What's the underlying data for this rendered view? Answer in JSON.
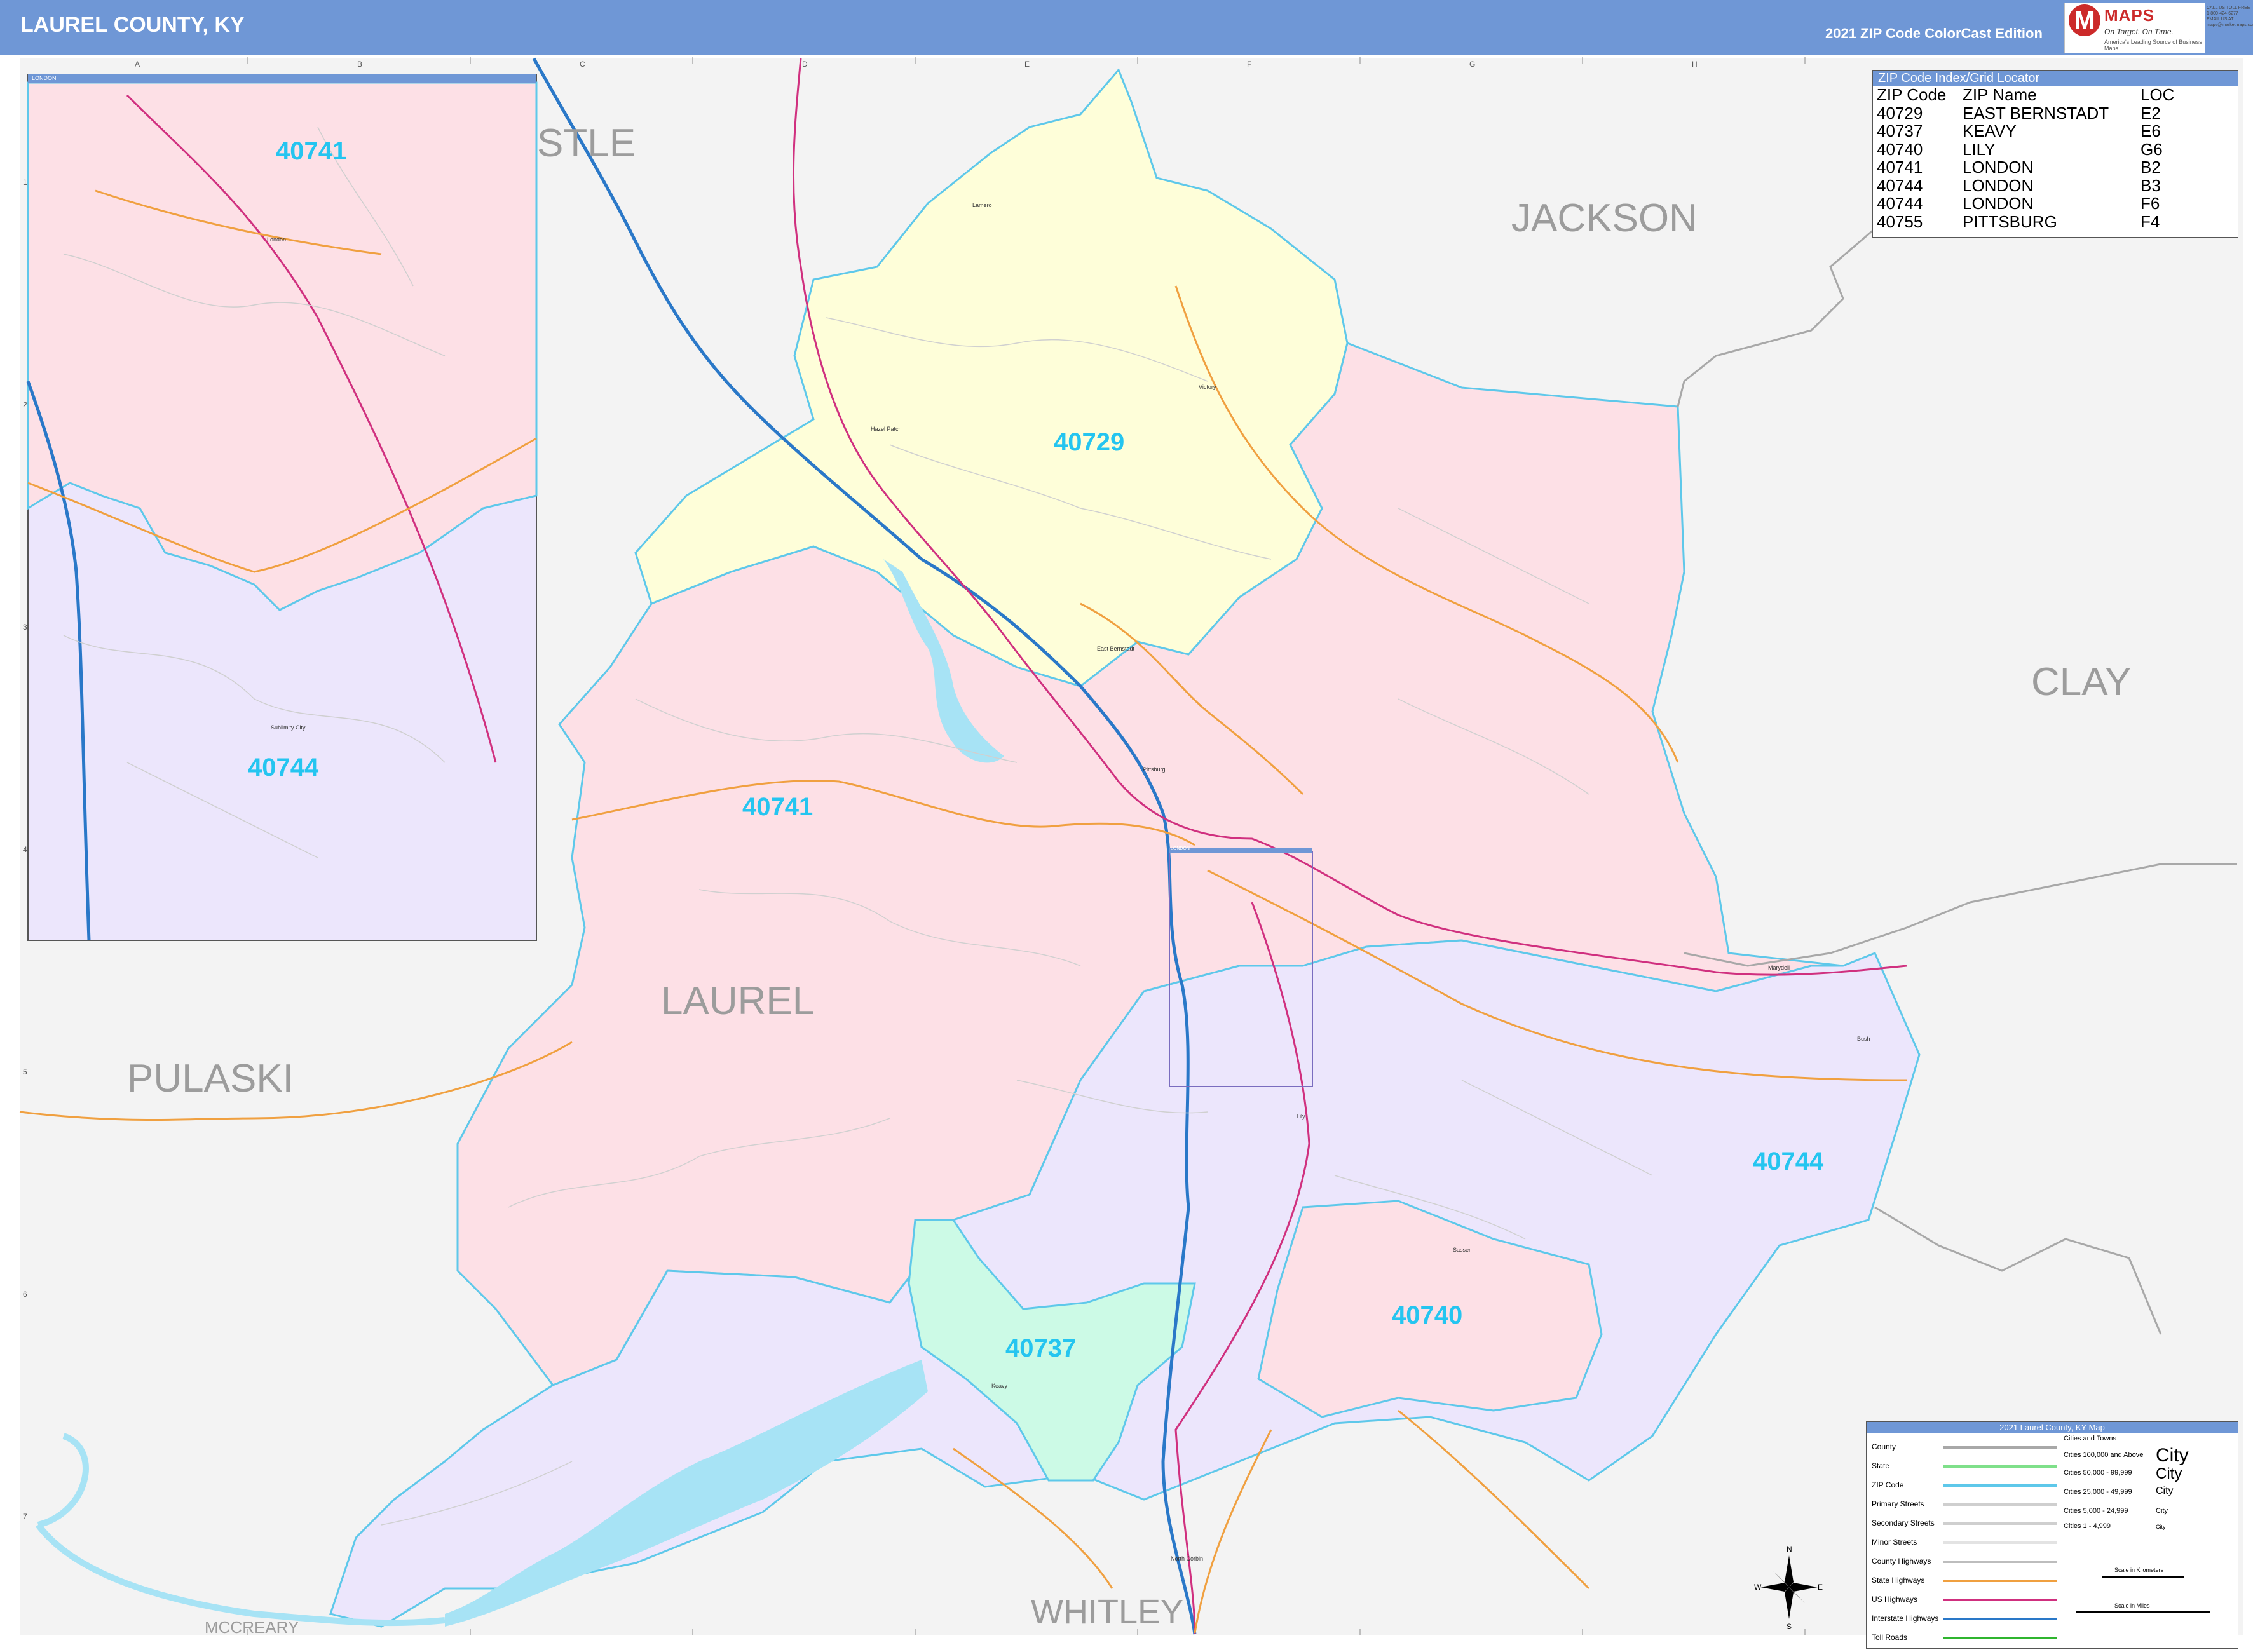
{
  "header": {
    "title": "LAUREL COUNTY, KY",
    "edition": "2021 ZIP Code ColorCast Edition"
  },
  "brand": {
    "logo_letter": "M",
    "logo_text": "MAPS",
    "tagline": "On Target. On Time.",
    "sub": "America's Leading Source of Business Maps",
    "contact": [
      "CALL US TOLL FREE",
      "1-800-424-6277",
      "EMAIL US AT",
      "maps@marketmaps.com"
    ]
  },
  "grid": {
    "columns": [
      "A",
      "B",
      "C",
      "D",
      "E",
      "F",
      "G",
      "H"
    ],
    "rows": [
      "1",
      "2",
      "3",
      "4",
      "5",
      "6",
      "7"
    ]
  },
  "counties": {
    "castle_partial": "STLE",
    "jackson": "JACKSON",
    "clay": "CLAY",
    "laurel": "LAUREL",
    "pulaski": "PULASKI",
    "whitley": "WHITLEY",
    "mccreary": "MCCREARY"
  },
  "zip_labels": {
    "z40729": "40729",
    "z40741_main": "40741",
    "z40744_east": "40744",
    "z40740": "40740",
    "z40737": "40737",
    "inset_40741": "40741",
    "inset_40744": "40744"
  },
  "cities": {
    "livingston": "Lamero",
    "victory": "Victory",
    "hazel_patch": "Hazel Patch",
    "east_bernstadt": "East Bernstadt",
    "pittsburg": "Pittsburg",
    "london": "London",
    "marydell": "Marydell",
    "bush": "Bush",
    "lily": "Lily",
    "sasser": "Sasser",
    "keavy": "Keavy",
    "north_corbin": "North Corbin",
    "sublimity_city": "Sublimity City",
    "inset_london": "London"
  },
  "inset": {
    "title": "LONDON"
  },
  "zip_index": {
    "title": "ZIP Code Index/Grid Locator",
    "columns": [
      "ZIP Code",
      "ZIP Name",
      "LOC"
    ],
    "rows": [
      [
        "40729",
        "EAST BERNSTADT",
        "E2"
      ],
      [
        "40737",
        "KEAVY",
        "E6"
      ],
      [
        "40740",
        "LILY",
        "G6"
      ],
      [
        "40741",
        "LONDON",
        "B2"
      ],
      [
        "40744",
        "LONDON",
        "B3"
      ],
      [
        "40744",
        "LONDON",
        "F6"
      ],
      [
        "40755",
        "PITTSBURG",
        "F4"
      ]
    ]
  },
  "legend": {
    "title": "2021 Laurel County, KY Map",
    "items": [
      {
        "label": "County",
        "color": "#a8a8a8"
      },
      {
        "label": "State",
        "color": "#7fe08a"
      },
      {
        "label": "ZIP Code",
        "color": "#5ec8ea"
      },
      {
        "label": "Primary Streets",
        "color": "#cfcfcf"
      },
      {
        "label": "Secondary Streets",
        "color": "#cfcfcf"
      },
      {
        "label": "Minor Streets",
        "color": "#e3e3e3"
      },
      {
        "label": "County Highways",
        "color": "#bdbdbd"
      },
      {
        "label": "State Highways",
        "color": "#f0a040"
      },
      {
        "label": "US Highways",
        "color": "#d0307f"
      },
      {
        "label": "Interstate Highways",
        "color": "#2a78c8"
      },
      {
        "label": "Toll Roads",
        "color": "#2fb52f"
      }
    ],
    "cities_header": "Cities and Towns",
    "city_classes": [
      {
        "label": "Cities 100,000 and Above",
        "sample": "City"
      },
      {
        "label": "Cities 50,000 - 99,999",
        "sample": "City"
      },
      {
        "label": "Cities 25,000 - 49,999",
        "sample": "City"
      },
      {
        "label": "Cities 5,000 - 24,999",
        "sample": "City"
      },
      {
        "label": "Cities 1 - 4,999",
        "sample": "City"
      }
    ],
    "scale_km": "Scale in Kilometers",
    "scale_mi": "Scale in Miles"
  },
  "compass": {
    "n": "N",
    "s": "S",
    "e": "E",
    "w": "W"
  },
  "colors": {
    "zip_40741": "#fde0e6",
    "zip_40744": "#ece6fc",
    "zip_40729": "#fefed9",
    "zip_40737": "#ccfae6",
    "zip_40740": "#fde0e6",
    "outside": "#f3f3f3",
    "water": "#a7e3f5",
    "zip_border": "#5ec8ea"
  }
}
